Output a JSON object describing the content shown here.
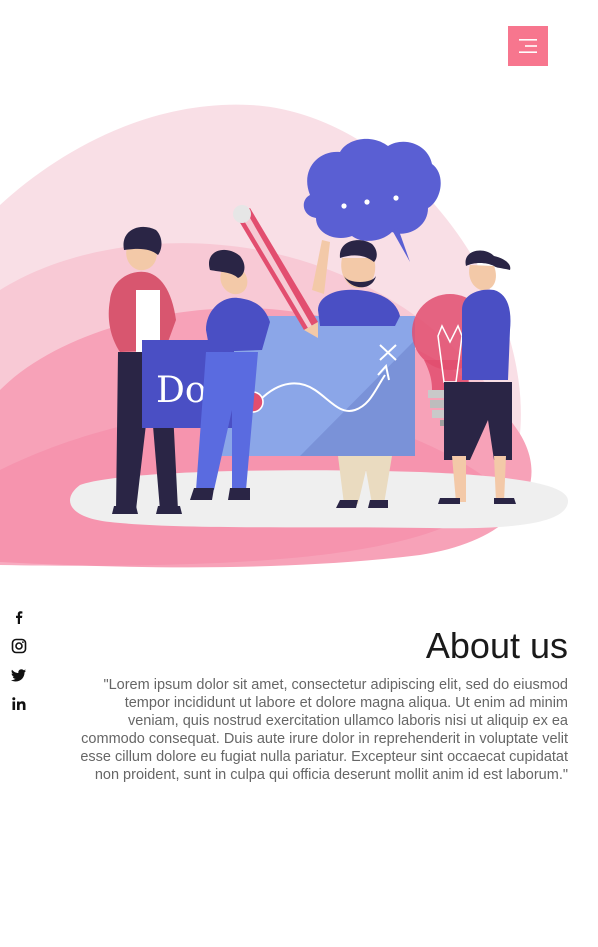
{
  "header": {
    "menu_icon": "hamburger-menu-icon",
    "accent_color": "#f7768e"
  },
  "hero": {
    "illustration": "team-brainstorm-illustration",
    "sign_text": "Do!"
  },
  "social": {
    "items": [
      {
        "icon": "facebook-icon"
      },
      {
        "icon": "instagram-icon"
      },
      {
        "icon": "twitter-icon"
      },
      {
        "icon": "linkedin-icon"
      }
    ]
  },
  "about": {
    "title": "About us",
    "body": "\"Lorem ipsum dolor sit amet, consectetur adipiscing elit, sed do eiusmod tempor incididunt ut labore et dolore magna aliqua. Ut enim ad minim veniam, quis nostrud exercitation ullamco laboris nisi ut aliquip ex ea commodo consequat. Duis aute irure dolor in reprehenderit in voluptate velit esse cillum dolore eu fugiat nulla pariatur. Excepteur sint occaecat cupidatat non proident, sunt in culpa qui officia deserunt mollit anim id est laborum.\""
  }
}
